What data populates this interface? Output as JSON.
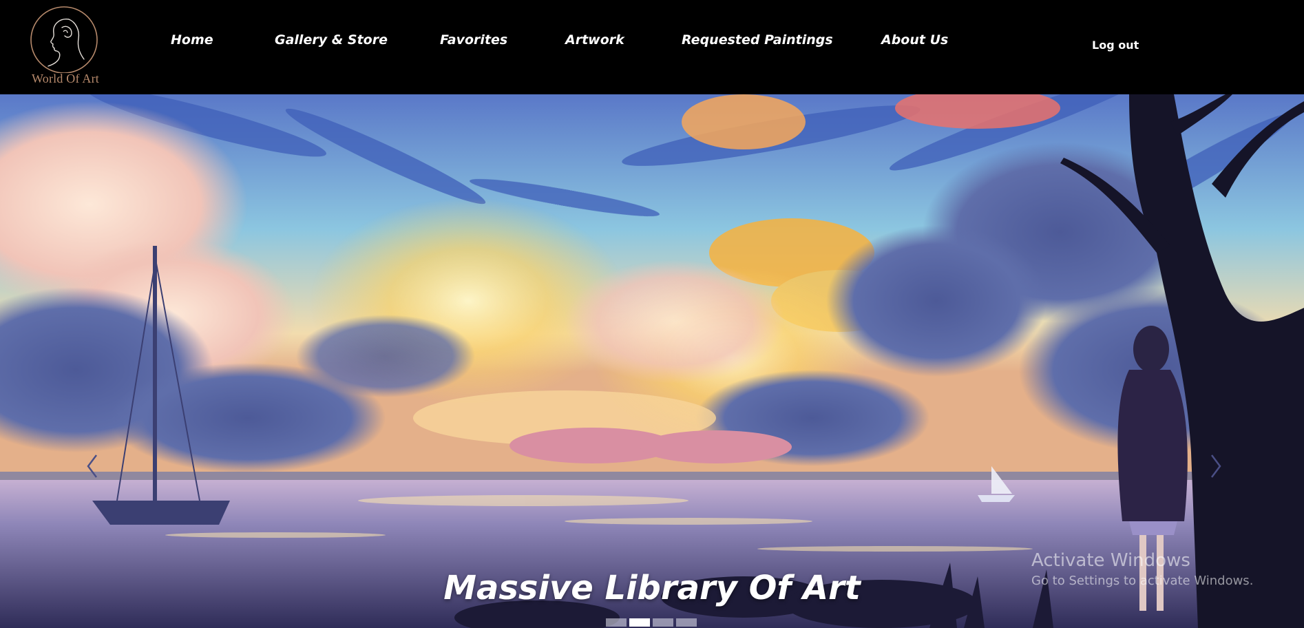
{
  "brand": {
    "name": "World Of Art",
    "logo_icon": "woman-profile-icon",
    "accent_color": "#b78a6c"
  },
  "nav": {
    "items": [
      {
        "label": "Home"
      },
      {
        "label": "Gallery & Store"
      },
      {
        "label": "Favorites"
      },
      {
        "label": "Artwork"
      },
      {
        "label": "Requested Paintings"
      },
      {
        "label": "About Us"
      }
    ],
    "logout_label": "Log out"
  },
  "hero": {
    "title": "Massive Library Of Art",
    "prev_icon": "chevron-left-icon",
    "next_icon": "chevron-right-icon",
    "slide_count": 4,
    "active_slide": 2
  },
  "system": {
    "activation_title": "Activate Windows",
    "activation_subtitle": "Go to Settings to activate Windows."
  }
}
